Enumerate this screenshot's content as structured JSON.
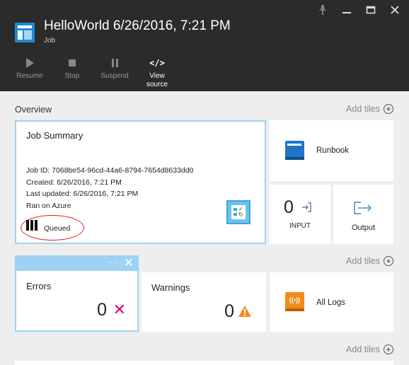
{
  "header": {
    "title": "HelloWorld 6/26/2016, 7:21 PM",
    "subtitle": "Job",
    "toolbar": [
      {
        "label": "Resume",
        "icon": "play-icon"
      },
      {
        "label": "Stop",
        "icon": "stop-icon"
      },
      {
        "label": "Suspend",
        "icon": "pause-icon"
      },
      {
        "label": "View\nsource",
        "icon": "code-icon"
      }
    ]
  },
  "overview": {
    "title": "Overview",
    "add_tiles": "Add tiles"
  },
  "job_summary": {
    "heading": "Job Summary",
    "job_id": "Job ID: 7068be54-96cd-44a6-8794-7654d8633dd0",
    "created": "Created: 6/26/2016, 7:21 PM",
    "last_updated": "Last updated: 6/26/2016, 7:21 PM",
    "ran_on": "Ran on Azure",
    "status": "Queued"
  },
  "runbook": {
    "label": "Runbook"
  },
  "input": {
    "count": "0",
    "label": "INPUT"
  },
  "output": {
    "label": "Output"
  },
  "streams": {
    "add_tiles": "Add tiles",
    "errors": {
      "heading": "Errors",
      "count": "0"
    },
    "warnings": {
      "heading": "Warnings",
      "count": "0"
    },
    "all_logs": {
      "label": "All Logs"
    }
  },
  "bottom": {
    "add_tiles": "Add tiles"
  },
  "colors": {
    "header_bg": "#2b2b2b",
    "accent_blue": "#1f8ad8",
    "selected_border": "#9dd2f5",
    "error_magenta": "#e0006f",
    "warning_orange": "#f28b1c",
    "annotation_red": "#e01b1b"
  }
}
